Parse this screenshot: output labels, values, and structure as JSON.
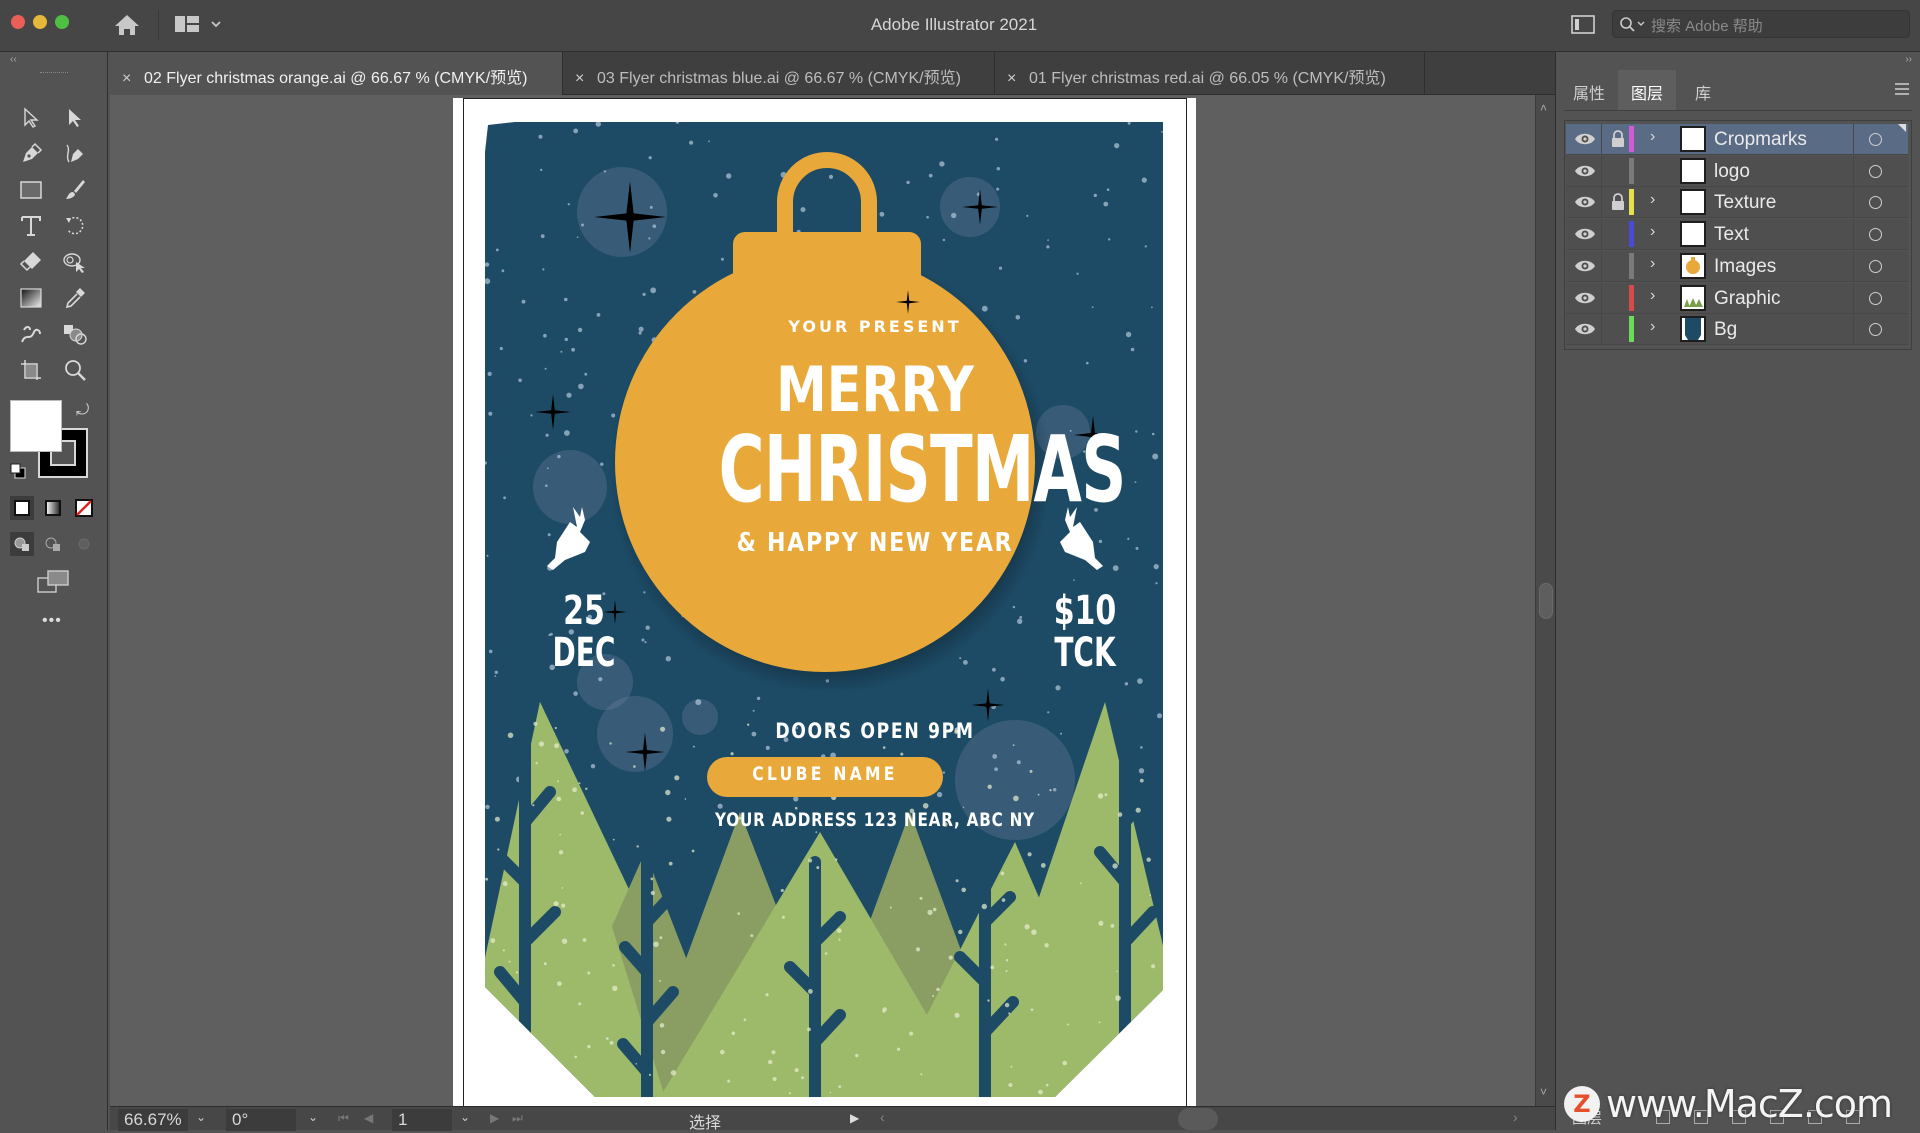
{
  "window": {
    "title": "Adobe Illustrator 2021",
    "search_placeholder": "搜索 Adobe 帮助"
  },
  "tabs": [
    {
      "label": "02 Flyer christmas orange.ai @ 66.67 % (CMYK/预览)",
      "active": true
    },
    {
      "label": "03 Flyer christmas blue.ai @ 66.67 % (CMYK/预览)",
      "active": false
    },
    {
      "label": "01 Flyer christmas red.ai @ 66.05 % (CMYK/预览)",
      "active": false
    }
  ],
  "toolbar": {
    "tools": [
      "selection-tool",
      "direct-selection-tool",
      "pen-tool",
      "curvature-tool",
      "rectangle-tool",
      "paintbrush-tool",
      "type-tool",
      "rotate-tool",
      "eraser-tool",
      "puppet-warp-tool",
      "gradient-tool",
      "eyedropper-tool",
      "symbol-sprayer-tool",
      "shape-builder-tool",
      "artboard-tool",
      "zoom-tool"
    ],
    "fill_color": "#ffffff",
    "stroke_color": "#000000",
    "more_label": "•••"
  },
  "panel": {
    "tabs": [
      {
        "label": "属性",
        "active": false
      },
      {
        "label": "图层",
        "active": true
      },
      {
        "label": "库",
        "active": false
      }
    ],
    "layers": [
      {
        "name": "Cropmarks",
        "color": "#d45ad8",
        "locked": true,
        "expandable": true,
        "selected": true,
        "thumb": "blank"
      },
      {
        "name": "logo",
        "color": "#7a7a7a",
        "locked": false,
        "expandable": false,
        "selected": false,
        "thumb": "blank"
      },
      {
        "name": "Texture",
        "color": "#e6e04a",
        "locked": true,
        "expandable": true,
        "selected": false,
        "thumb": "blank"
      },
      {
        "name": "Text",
        "color": "#4a4ad8",
        "locked": false,
        "expandable": true,
        "selected": false,
        "thumb": "blank"
      },
      {
        "name": "Images",
        "color": "#7a7a7a",
        "locked": false,
        "expandable": true,
        "selected": false,
        "thumb": "ornament"
      },
      {
        "name": "Graphic",
        "color": "#d84a4a",
        "locked": false,
        "expandable": true,
        "selected": false,
        "thumb": "trees"
      },
      {
        "name": "Bg",
        "color": "#6adc5a",
        "locked": false,
        "expandable": true,
        "selected": false,
        "thumb": "bg"
      }
    ],
    "footer_label": "图层"
  },
  "statusbar": {
    "zoom": "66.67%",
    "rotation": "0°",
    "artboard": "1",
    "tool_status": "选择"
  },
  "poster": {
    "subtitle": "YOUR PRESENT",
    "title_line1": "MERRY",
    "title_line2": "CHRISTMAS",
    "tagline": "& HAPPY NEW YEAR",
    "date_day": "25",
    "date_month": "DEC",
    "price": "$10",
    "price_unit": "TCK",
    "doors": "DOORS OPEN 9PM",
    "venue": "CLUBE NAME",
    "address": "YOUR ADDRESS 123 NEAR, ABC NY",
    "colors": {
      "background": "#1d4b66",
      "ornament": "#e8a93a",
      "tree_light": "#9dba6a",
      "tree_dark": "#8a9d63"
    }
  },
  "watermark": "www.MacZ.com"
}
